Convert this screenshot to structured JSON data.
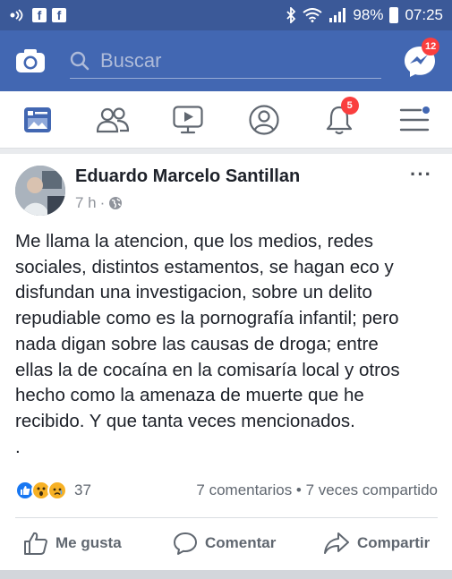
{
  "status_bar": {
    "battery": "98%",
    "time": "07:25",
    "fb_a": "f",
    "fb_b": "f"
  },
  "search": {
    "placeholder": "Buscar",
    "messenger_badge": "12"
  },
  "nav": {
    "notifications_badge": "5"
  },
  "post": {
    "author": "Eduardo Marcelo Santillan",
    "time": "7 h",
    "more": "···",
    "text": "Me llama la atencion, que los medios, redes\nsociales,  distintos estamentos, se hagan eco y\ndisfundan  una investigacion, sobre un delito\nrepudiable como es la pornografía infantil; pero\nnada digan sobre las causas de droga;  entre\nellas la de cocaína en la comisaría local y otros\nhecho como la amenaza de muerte que he\nrecibido. Y que tanta veces mencionados.\n.",
    "reaction_count": "37",
    "stats": "7 comentarios • 7 veces compartido"
  },
  "actions": {
    "like": "Me gusta",
    "comment": "Comentar",
    "share": "Compartir"
  },
  "colors": {
    "header": "#4267b2",
    "status": "#3b5998",
    "badge": "#fa3e3e",
    "accent": "#4267b2"
  }
}
